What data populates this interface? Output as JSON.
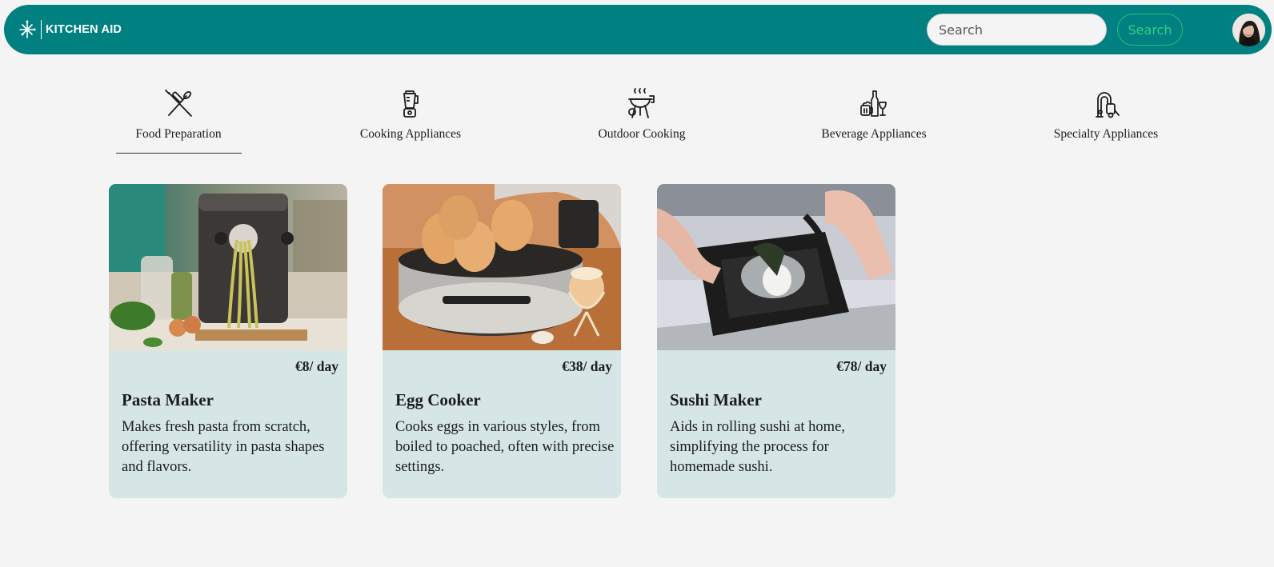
{
  "header": {
    "logo_text": "KITCHEN AID",
    "search": {
      "placeholder": "Search",
      "value": ""
    },
    "search_button_label": "Search"
  },
  "categories": [
    {
      "label": "Food Preparation",
      "icon": "whisk-rolling-pin-icon",
      "selected": true
    },
    {
      "label": "Cooking Appliances",
      "icon": "blender-icon",
      "selected": false
    },
    {
      "label": "Outdoor Cooking",
      "icon": "grill-icon",
      "selected": false
    },
    {
      "label": "Beverage Appliances",
      "icon": "beverage-icon",
      "selected": false
    },
    {
      "label": "Specialty Appliances",
      "icon": "vacuum-icon",
      "selected": false
    }
  ],
  "products": [
    {
      "price": "€8/ day",
      "title": "Pasta Maker",
      "description": "Makes fresh pasta from scratch, offering versatility in pasta shapes and flavors.",
      "image": "pasta-maker-photo"
    },
    {
      "price": "€38/ day",
      "title": "Egg Cooker",
      "description": "Cooks eggs in various styles, from boiled to poached, often with precise settings.",
      "image": "egg-cooker-photo"
    },
    {
      "price": "€78/ day",
      "title": "Sushi Maker",
      "description": "Aids in rolling sushi at home, simplifying the process for homemade sushi.",
      "image": "sushi-maker-photo"
    }
  ],
  "colors": {
    "header": "#008080",
    "accent": "#2ed183",
    "card": "#d6e6e6",
    "background": "#f4f4f4"
  }
}
